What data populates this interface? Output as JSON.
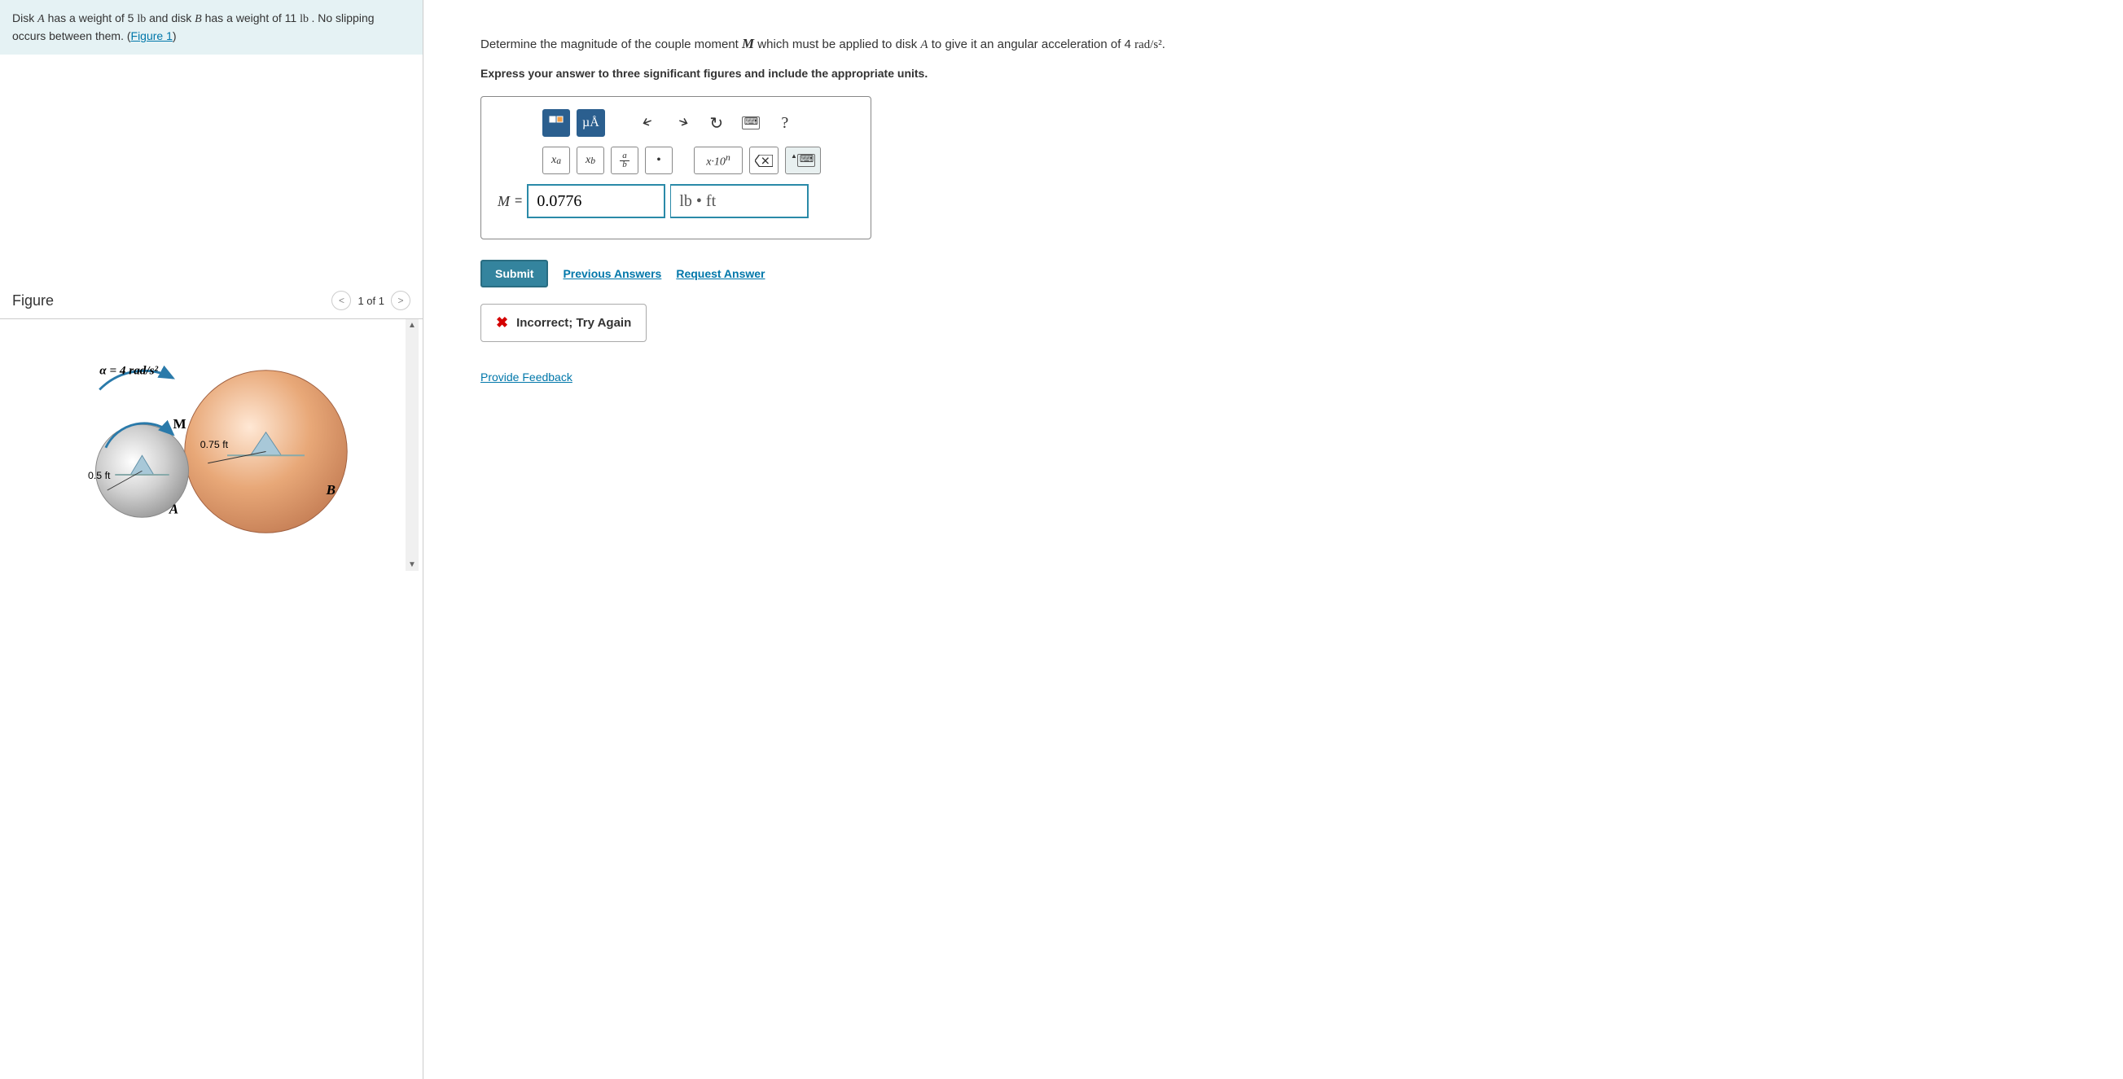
{
  "problem": {
    "text_prefix": "Disk ",
    "weight_a": " has a weight of 5 ",
    "unit_lb1": "lb",
    "mid1": " and disk ",
    "weight_b": " has a weight of 11 ",
    "unit_lb2": " lb ",
    "text_suffix": ". No slipping occurs between them. (",
    "figure_link": "Figure 1",
    "closing": ")"
  },
  "figure": {
    "title": "Figure",
    "pager": "1 of 1",
    "alpha_label": "α = 4 rad/s²",
    "moment_label": "M",
    "radius_a": "0.5 ft",
    "radius_b": "0.75 ft",
    "disk_a": "A",
    "disk_b": "B"
  },
  "question": {
    "prefix": "Determine the magnitude of the couple moment ",
    "var_m": "M",
    "mid1": " which must be applied to disk ",
    "var_a": "A",
    "mid2": " to give it an angular acceleration of 4 ",
    "unit": "rad/s²",
    "suffix": ".",
    "instruction": "Express your answer to three significant figures and include the appropriate units."
  },
  "toolbar": {
    "templates": "▫▫",
    "micro": "µÅ",
    "undo": "↶",
    "redo": "↷",
    "reset": "↻",
    "keyboard": "⌨",
    "help": "?",
    "superscript": "xᵃ",
    "subscript": "xᵦ",
    "fraction_top": "a",
    "fraction_bot": "b",
    "dot": "•",
    "sci": "x·10ⁿ",
    "backspace": "⌫",
    "keyboard2": "⌨"
  },
  "answer": {
    "var": "M",
    "eq": " = ",
    "value": "0.0776",
    "unit": "lb • ft"
  },
  "actions": {
    "submit": "Submit",
    "previous": "Previous Answers",
    "request": "Request Answer"
  },
  "feedback": {
    "message": "Incorrect; Try Again"
  },
  "footer": {
    "provide_feedback": "Provide Feedback"
  }
}
